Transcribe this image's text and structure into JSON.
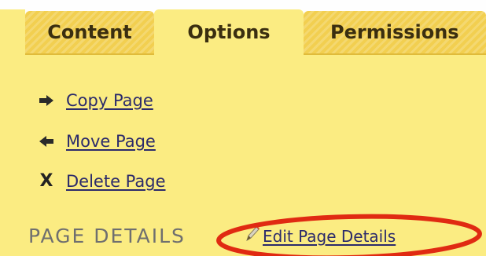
{
  "tabs": [
    {
      "label": "Content",
      "active": false
    },
    {
      "label": "Options",
      "active": true
    },
    {
      "label": "Permissions",
      "active": false
    }
  ],
  "actions": [
    {
      "label": "Copy Page",
      "icon": "arrow-right-icon"
    },
    {
      "label": "Move Page",
      "icon": "arrow-left-icon"
    },
    {
      "label": "Delete Page",
      "icon": "delete-x-icon"
    }
  ],
  "page_details": {
    "section_title": "PAGE DETAILS",
    "edit_label": "Edit Page Details",
    "edit_icon": "pencil-icon"
  },
  "annotation": {
    "shape": "ellipse",
    "color": "#e02a12"
  },
  "colors": {
    "panel": "#fbec82",
    "tab_inactive": "#f2cf50",
    "link": "#2b2a6b",
    "section_title": "#6f6f6f"
  }
}
